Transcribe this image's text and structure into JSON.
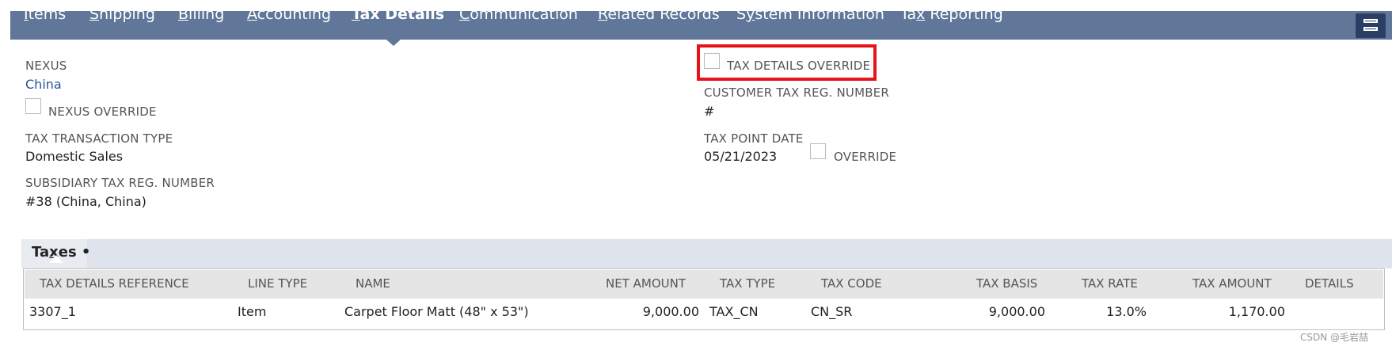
{
  "tabs": [
    {
      "pre": "",
      "mn": "I",
      "post": "tems",
      "active": false
    },
    {
      "pre": "",
      "mn": "S",
      "post": "hipping",
      "active": false
    },
    {
      "pre": "",
      "mn": "B",
      "post": "illing",
      "active": false
    },
    {
      "pre": "",
      "mn": "A",
      "post": "ccounting",
      "active": false
    },
    {
      "pre": "",
      "mn": "T",
      "post": "ax Details",
      "active": true
    },
    {
      "pre": "",
      "mn": "C",
      "post": "ommunication",
      "active": false
    },
    {
      "pre": "",
      "mn": "R",
      "post": "elated Records",
      "active": false
    },
    {
      "pre": "S",
      "mn": "y",
      "post": "stem Information",
      "active": false
    },
    {
      "pre": "Ta",
      "mn": "x",
      "post": " Reporting",
      "active": false
    }
  ],
  "fields": {
    "nexus_label": "NEXUS",
    "nexus_value": "China",
    "nexus_override_label": "NEXUS OVERRIDE",
    "tax_transaction_type_label": "TAX TRANSACTION TYPE",
    "tax_transaction_type_value": "Domestic Sales",
    "subsidiary_tax_reg_label": "SUBSIDIARY TAX REG. NUMBER",
    "subsidiary_tax_reg_value": "#38 (China, China)",
    "tax_details_override_label": "TAX DETAILS OVERRIDE",
    "customer_tax_reg_label": "CUSTOMER TAX REG. NUMBER",
    "customer_tax_reg_value": "#",
    "tax_point_date_label": "TAX POINT DATE",
    "tax_point_date_value": "05/21/2023",
    "tax_point_override_label": "OVERRIDE"
  },
  "taxes": {
    "title_pre": "Ta",
    "title_mn": "x",
    "title_post": "es •",
    "columns": [
      "TAX DETAILS REFERENCE",
      "LINE TYPE",
      "NAME",
      "NET AMOUNT",
      "TAX TYPE",
      "TAX CODE",
      "TAX BASIS",
      "TAX RATE",
      "TAX AMOUNT",
      "DETAILS"
    ],
    "rows": [
      [
        "3307_1",
        "Item",
        "Carpet Floor Matt (48\" x 53\")",
        "9,000.00",
        "TAX_CN",
        "CN_SR",
        "9,000.00",
        "13.0%",
        "1,170.00",
        ""
      ]
    ]
  },
  "watermark": "CSDN @毛岩喆"
}
